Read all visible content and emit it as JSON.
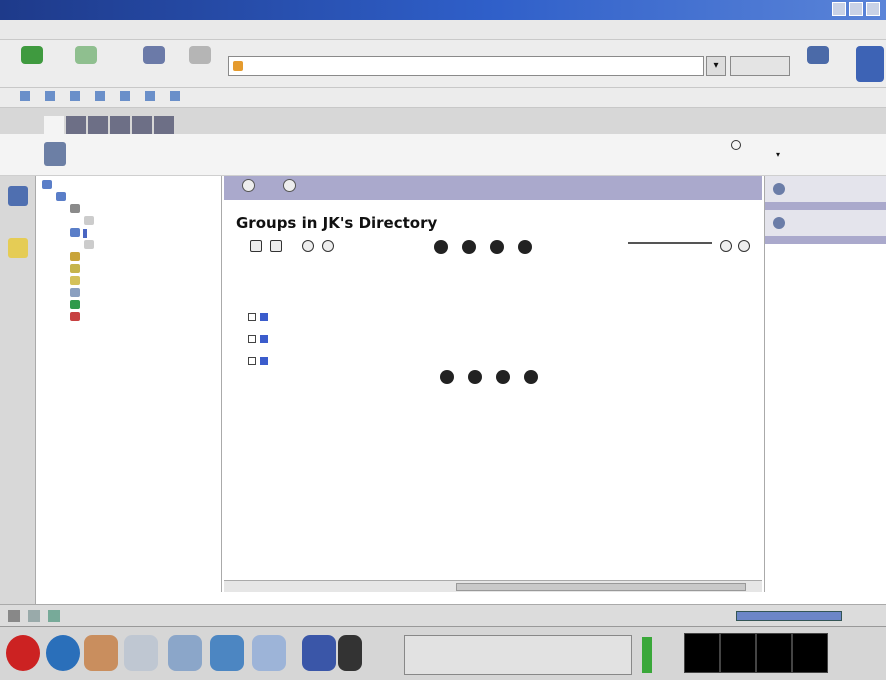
{
  "window": {
    "title": ""
  },
  "menubar": [
    "",
    "",
    "",
    "",
    "",
    "",
    "",
    ""
  ],
  "nav": {
    "back": "",
    "forward": "",
    "reload": "",
    "stop": "",
    "url": "",
    "search": "",
    "print": ""
  },
  "bookmarks": [
    "",
    "",
    "",
    "",
    "",
    "",
    ""
  ],
  "app_tabs": [
    "",
    "",
    "",
    "",
    "",
    ""
  ],
  "right_links": [
    "",
    "",
    ""
  ],
  "header": {
    "name": "",
    "refresh": "",
    "tools": ""
  },
  "tree": [
    {
      "label": "",
      "indent": 0
    },
    {
      "label": "",
      "indent": 1
    },
    {
      "label": "",
      "indent": 2
    },
    {
      "label": "",
      "indent": 3
    },
    {
      "label": "",
      "indent": 2
    },
    {
      "label": "",
      "indent": 3
    },
    {
      "label": "",
      "indent": 2
    },
    {
      "label": "",
      "indent": 2
    },
    {
      "label": "",
      "indent": 2
    },
    {
      "label": "",
      "indent": 2
    },
    {
      "label": "",
      "indent": 2
    },
    {
      "label": "",
      "indent": 2
    }
  ],
  "main": {
    "toolbar": [
      "",
      ""
    ],
    "title": "Groups in JK's Directory",
    "columns": [
      "",
      "",
      ""
    ],
    "rows": [
      {
        "name": "",
        "category": "",
        "description": ""
      },
      {
        "name": "",
        "category": "",
        "description": ""
      },
      {
        "name": "",
        "category": "",
        "description": ""
      }
    ]
  },
  "rpanel": {
    "section1": "",
    "items1": [
      "",
      "",
      ""
    ],
    "section2": "",
    "items2": [
      "",
      ""
    ]
  },
  "taskbar": {
    "active": "",
    "clock": ""
  }
}
